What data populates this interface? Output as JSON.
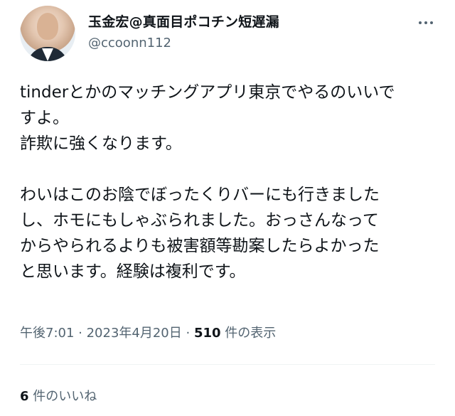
{
  "author": {
    "display_name": "玉金宏@真面目ポコチン短遅漏",
    "handle": "@ccoonn112"
  },
  "icons": {
    "more": "more-horizontal-icon",
    "avatar": "profile-photo"
  },
  "tweet": {
    "lines_block1": [
      "tinderとかのマッチングアプリ東京でやるのいいで",
      "すよ。",
      "詐欺に強くなります。"
    ],
    "lines_block2": [
      "わいはこのお陰でぼったくりバーにも行きました",
      "し、ホモにもしゃぶられました。おっさんなって",
      "からやられるよりも被害額等勘案したらよかった",
      "と思います。経験は複利です。"
    ]
  },
  "meta": {
    "time": "午後7:01",
    "separator1": " · ",
    "date": "2023年4月20日",
    "separator2": " · ",
    "views_count": "510",
    "views_label": " 件の表示"
  },
  "likes": {
    "count": "6",
    "label": " 件のいいね"
  },
  "colors": {
    "text": "#0f1419",
    "secondary": "#536471",
    "divider": "#eff3f4"
  }
}
